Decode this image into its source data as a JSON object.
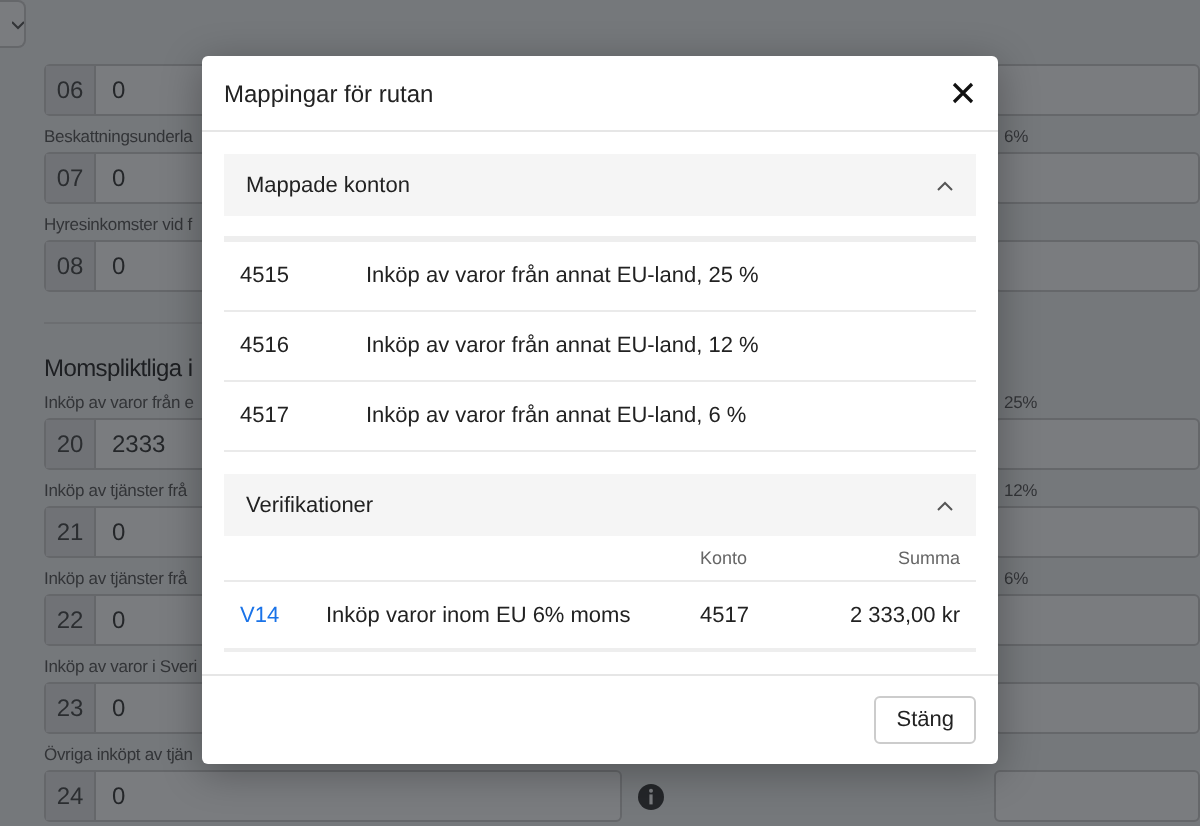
{
  "form": {
    "sections": [
      {
        "rows": [
          {
            "number": "06",
            "value": "0"
          },
          {
            "label": "Beskattningsunderla",
            "number": "07",
            "value": "0",
            "right_label": "6%"
          },
          {
            "label": "Hyresinkomster vid f",
            "number": "08",
            "value": "0"
          }
        ]
      },
      {
        "heading": "Momspliktliga i",
        "rows": [
          {
            "label": "Inköp av varor från e",
            "number": "20",
            "value": "2333",
            "right_label": "25%"
          },
          {
            "label": "Inköp av tjänster frå",
            "number": "21",
            "value": "0",
            "right_label": "12%"
          },
          {
            "label": "Inköp av tjänster frå",
            "number": "22",
            "value": "0",
            "right_label": "6%"
          },
          {
            "label": "Inköp av varor i Sveri",
            "number": "23",
            "value": "0"
          },
          {
            "label": "Övriga inköpt av tjän",
            "number": "24",
            "value": "0",
            "info": true
          }
        ]
      }
    ]
  },
  "modal": {
    "title": "Mappingar för rutan",
    "sections": [
      {
        "kind": "accounts",
        "title": "Mappade konton",
        "expanded": true,
        "rows": [
          {
            "account": "4515",
            "name": "Inköp av varor från annat EU-land, 25 %"
          },
          {
            "account": "4516",
            "name": "Inköp av varor från annat EU-land, 12 %"
          },
          {
            "account": "4517",
            "name": "Inköp av varor från annat EU-land, 6 %"
          }
        ]
      },
      {
        "kind": "vouchers",
        "title": "Verifikationer",
        "expanded": true,
        "columns": [
          "Konto",
          "Summa"
        ],
        "rows": [
          {
            "id": "V14",
            "description": "Inköp varor inom EU 6% moms",
            "account": "4517",
            "amount": "2 333,00 kr"
          }
        ]
      }
    ],
    "button": "Stäng"
  }
}
